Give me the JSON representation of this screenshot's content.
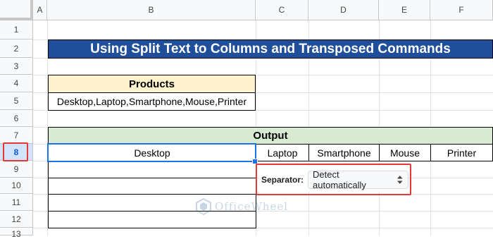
{
  "columns": [
    "A",
    "B",
    "C",
    "D",
    "E",
    "F"
  ],
  "rows": [
    "1",
    "2",
    "3",
    "4",
    "5",
    "6",
    "7",
    "8",
    "9",
    "10",
    "11",
    "12",
    "13"
  ],
  "title": "Using Split Text to Columns and Transposed Commands",
  "products_header": "Products",
  "products_value": "Desktop,Laptop,Smartphone,Mouse,Printer",
  "output_header": "Output",
  "output_values": [
    "Desktop",
    "Laptop",
    "Smartphone",
    "Mouse",
    "Printer"
  ],
  "separator": {
    "label": "Separator:",
    "value": "Detect automatically"
  },
  "watermark": "OfficeWheel",
  "colors": {
    "title_bg": "#1f4e9a",
    "products_bg": "#fff2cc",
    "output_bg": "#d9ead3",
    "selection": "#1a73e8",
    "highlight": "#e53935"
  }
}
